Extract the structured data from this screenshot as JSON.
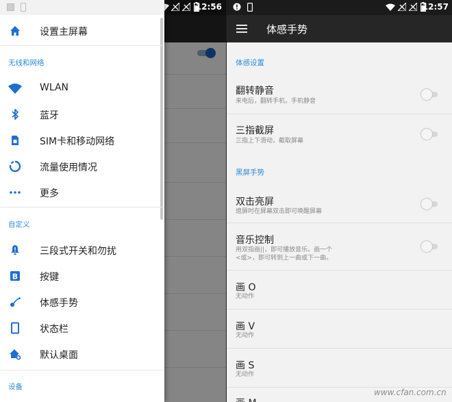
{
  "colors": {
    "accent": "#2e8ad8",
    "icon": "#1e6fd0",
    "toolbar": "#262626",
    "status_bar": "#1b1b1b"
  },
  "left": {
    "status_time": "12:56",
    "drawer": {
      "top_item": {
        "label": "设置主屏幕",
        "icon": "home-icon"
      },
      "sections": [
        {
          "header": "无线和网络",
          "items": [
            {
              "label": "WLAN",
              "icon": "wifi-icon"
            },
            {
              "label": "蓝牙",
              "icon": "bluetooth-icon"
            },
            {
              "label": "SIM卡和移动网络",
              "icon": "sim-card-icon"
            },
            {
              "label": "流量使用情况",
              "icon": "data-usage-icon"
            },
            {
              "label": "更多",
              "icon": "more-icon"
            }
          ]
        },
        {
          "header": "自定义",
          "items": [
            {
              "label": "三段式开关和勿扰",
              "icon": "alert-slider-icon"
            },
            {
              "label": "按键",
              "icon": "buttons-icon"
            },
            {
              "label": "体感手势",
              "icon": "gestures-icon"
            },
            {
              "label": "状态栏",
              "icon": "status-bar-icon"
            },
            {
              "label": "默认桌面",
              "icon": "default-home-icon"
            }
          ]
        },
        {
          "header": "设备",
          "items": []
        }
      ]
    }
  },
  "right": {
    "status_time": "12:57",
    "toolbar_title": "体感手势",
    "sections": [
      {
        "header": "体感设置",
        "items": [
          {
            "title": "翻转静音",
            "summary": "来电后，翻转手机，手机静音",
            "toggle": false
          },
          {
            "title": "三指截屏",
            "summary": "三指上下滑动，截取屏幕",
            "toggle": false
          }
        ]
      },
      {
        "header": "黑屏手势",
        "items": [
          {
            "title": "双击亮屏",
            "summary": "熄屏时在屏幕双击即可唤醒屏幕",
            "toggle": false
          },
          {
            "title": "音乐控制",
            "summary": "用双指画||，即可播放音乐。画一个",
            "summary2": "<或>，即可转到上一曲或下一曲。",
            "toggle": false
          },
          {
            "title": "画 O",
            "summary": "无动作"
          },
          {
            "title": "画 V",
            "summary": "无动作"
          },
          {
            "title": "画 S",
            "summary": "无动作"
          },
          {
            "title": "画 M",
            "summary": ""
          }
        ]
      }
    ],
    "watermark": "www.cfan.com.cn"
  }
}
